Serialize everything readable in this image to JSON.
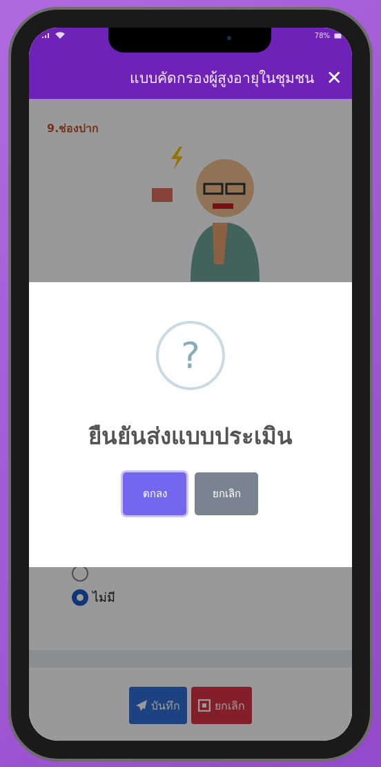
{
  "status_bar": {
    "battery": "78%"
  },
  "header": {
    "title": "แบบคัดกรองผู้สูงอายุในชุมชน",
    "close": "✕"
  },
  "question": {
    "title": "9.ช่องปาก",
    "options": [
      {
        "selected": false
      },
      {
        "label": "ไม่มี",
        "selected": true
      }
    ]
  },
  "dialog": {
    "icon": "?",
    "title": "ยืนยันส่งแบบประเมิน",
    "buttons": [
      {
        "label": "ตกลง",
        "kind": "confirm"
      },
      {
        "label": "ยกเลิก",
        "kind": "cancel"
      }
    ]
  },
  "footer": {
    "buttons": [
      {
        "label": "บันทึก",
        "kind": "save"
      },
      {
        "label": "ยกเลิก",
        "kind": "cancel"
      }
    ]
  }
}
